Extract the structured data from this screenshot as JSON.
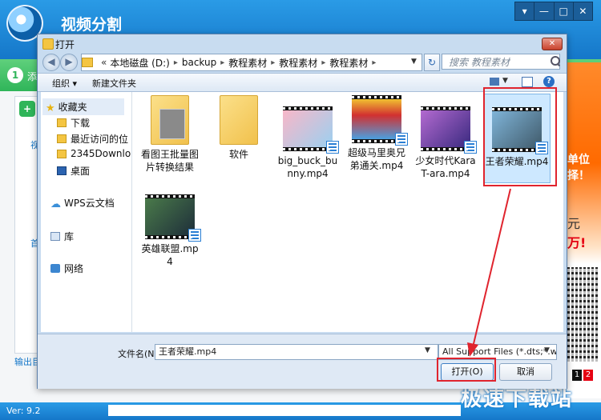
{
  "app": {
    "title": "视频分割",
    "window_buttons": [
      "▾",
      "—",
      "□",
      "✕"
    ],
    "step_number": "1",
    "step_text": "添",
    "left_tab1": "视",
    "left_tab2": "首",
    "output_dir_label": "输出目",
    "version": "Ver: 9.2",
    "ad": {
      "text1": "单位\n择！",
      "text2": "元",
      "text3": "万!",
      "pages": [
        "1",
        "2"
      ],
      "colors": {
        "orange": "#ff6a00",
        "red": "#e60012"
      }
    },
    "watermark": "极速下载站",
    "colors": {
      "header_blue": "#1577c9",
      "green": "#2fb559"
    }
  },
  "dialog": {
    "title": "打开",
    "address": {
      "prefix": "«",
      "crumbs": [
        "本地磁盘 (D:)",
        "backup",
        "教程素材",
        "教程素材",
        "教程素材"
      ]
    },
    "search_placeholder": "搜索 教程素材",
    "toolbar": {
      "organize": "组织 ▾",
      "new_folder": "新建文件夹"
    },
    "nav": {
      "favorites": "收藏夹",
      "downloads": "下载",
      "recent": "最近访问的位",
      "folder_2345": "2345Downlo",
      "desktop": "桌面",
      "wps_cloud": "WPS云文档",
      "library": "库",
      "network": "网络"
    },
    "files": [
      {
        "name": "看图王批量图片转换结果",
        "type": "folder"
      },
      {
        "name": "软件",
        "type": "folder"
      },
      {
        "name": "big_buck_bunny.mp4",
        "type": "video"
      },
      {
        "name": "超级马里奥兄弟通关.mp4",
        "type": "video"
      },
      {
        "name": "少女时代KaraT-ara.mp4",
        "type": "video"
      },
      {
        "name": "王者荣耀.mp4",
        "type": "video",
        "selected": true
      },
      {
        "name": "英雄联盟.mp4",
        "type": "video"
      }
    ],
    "filename_label": "文件名(N):",
    "filename_value": "王者荣耀.mp4",
    "filter_value": "All Support Files (*.dts;*.web",
    "open_label": "打开(O)",
    "cancel_label": "取消"
  }
}
